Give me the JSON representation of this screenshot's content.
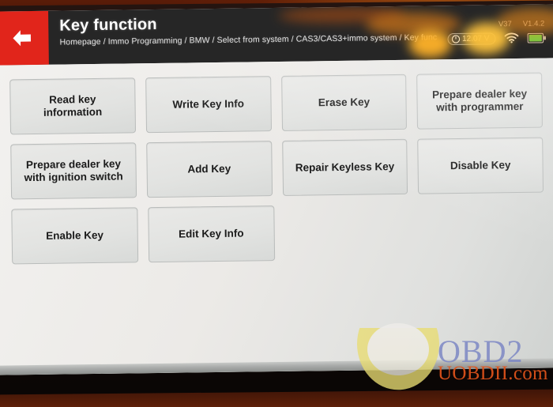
{
  "header": {
    "back_icon": "arrow-left-icon",
    "title": "Key function",
    "breadcrumb": "Homepage / Immo Programming / BMW / Select from  system / CAS3/CAS3+immo system / Key func",
    "accent_color": "#e1251b",
    "bar_color": "#262626"
  },
  "status": {
    "version_vci": "V37",
    "version_app": "V1.4.2",
    "voltage": "12.07 V",
    "voltage_icon": "power-circle-icon",
    "wifi_icon": "wifi-icon",
    "battery_icon": "battery-icon",
    "battery_color": "#7ac943"
  },
  "menu": {
    "rows": [
      [
        {
          "label": "Read key\ninformation"
        },
        {
          "label": "Write Key Info"
        },
        {
          "label": "Erase Key"
        },
        {
          "label": "Prepare dealer key\nwith programmer"
        }
      ],
      [
        {
          "label": "Prepare dealer key\nwith ignition switch"
        },
        {
          "label": "Add Key"
        },
        {
          "label": "Repair Keyless Key"
        },
        {
          "label": "Disable Key"
        }
      ],
      [
        {
          "label": "Enable Key"
        },
        {
          "label": "Edit Key Info"
        },
        {
          "label": ""
        },
        {
          "label": ""
        }
      ]
    ]
  },
  "watermark": {
    "brand": "OBD2",
    "site": "UOBDII.com",
    "brand_color": "#7b86c4",
    "site_color": "#e2541b",
    "bowl_color": "#e8dc72"
  }
}
